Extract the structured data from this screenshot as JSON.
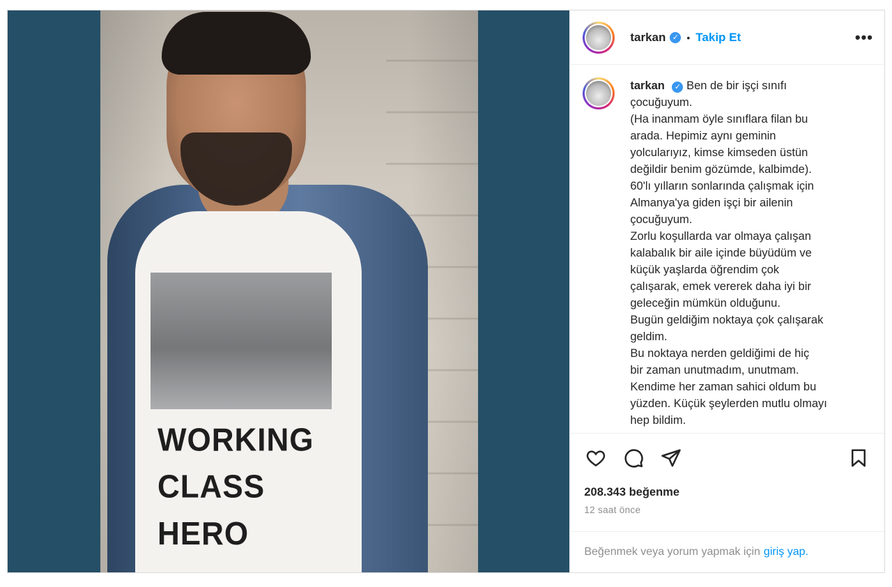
{
  "post": {
    "username": "tarkan",
    "follow_label": "Takip Et",
    "separator": "•",
    "more_label": "•••",
    "shirt_text": "WORKING\nCLASS\nHERO",
    "caption_username": "tarkan",
    "caption_text": "Ben de bir işçi sınıfı\nçocuğuyum.\n(Ha inanmam öyle sınıflara filan bu\narada. Hepimiz aynı geminin\nyolcularıyız, kimse kimseden üstün\ndeğildir benim gözümde, kalbimde).\n60'lı yılların sonlarında çalışmak için\nAlmanya'ya giden işçi bir ailenin\nçocuğuyum.\nZorlu koşullarda var olmaya çalışan\nkalabalık bir aile içinde büyüdüm ve\nküçük yaşlarda öğrendim çok\nçalışarak, emek vererek daha iyi bir\ngeleceğin mümkün olduğunu.\nBugün geldiğim noktaya çok çalışarak\ngeldim.\nBu noktaya nerden geldiğimi de hiç\nbir zaman unutmadım, unutmam.\nKendime her zaman sahici oldum bu\nyüzden. Küçük şeylerden mutlu olmayı\nhep bildim.\nHer şeyden önce, iyi insan kalabilmeyi",
    "likes": "208.343 beğenme",
    "time_ago": "12 saat önce",
    "login_prompt": "Beğenmek veya yorum yapmak için",
    "login_link": "giriş yap."
  },
  "icons": {
    "verified": "verified-badge-icon",
    "like": "heart-icon",
    "comment": "comment-icon",
    "share": "share-icon",
    "save": "bookmark-icon"
  },
  "colors": {
    "media_bg": "#254f67",
    "link": "#0095f6",
    "verified": "#3897f0",
    "muted": "#8e8e8e"
  }
}
